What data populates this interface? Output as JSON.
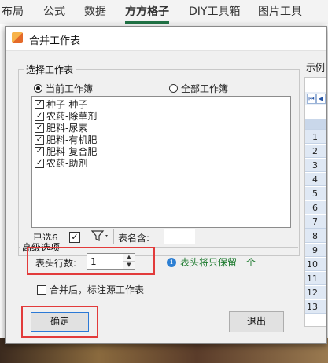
{
  "ribbon": {
    "tabs": [
      "布局",
      "公式",
      "数据",
      "方方格子",
      "DIY工具箱",
      "图片工具"
    ],
    "active_tab": "方方格子"
  },
  "dialog": {
    "title": "合并工作表",
    "select_group": {
      "label": "选择工作表",
      "radio_current": "当前工作簿",
      "radio_all": "全部工作簿",
      "selected_radio": "当前工作簿",
      "items": [
        {
          "label": "种子-种子",
          "checked": true
        },
        {
          "label": "农药-除草剂",
          "checked": true
        },
        {
          "label": "肥料-尿素",
          "checked": true
        },
        {
          "label": "肥料-有机肥",
          "checked": true
        },
        {
          "label": "肥料-复合肥",
          "checked": true
        },
        {
          "label": "农药-助剂",
          "checked": true
        }
      ],
      "selected_count": "已选6",
      "sheet_name_contains": "表名含:"
    },
    "advanced": {
      "label": "高级选项",
      "header_rows_label": "表头行数:",
      "header_rows_value": "1",
      "info_text": "表头将只保留一个",
      "mark_source_label": "合并后，标注源工作表"
    },
    "buttons": {
      "ok": "确定",
      "exit": "退出"
    },
    "sample": {
      "label": "示例",
      "row_numbers": [
        "1",
        "2",
        "3",
        "4",
        "5",
        "6",
        "7",
        "8",
        "9",
        "10",
        "11",
        "12",
        "13"
      ]
    }
  },
  "colors": {
    "highlight_red": "#e23b3b",
    "info_green": "#1d7a2e",
    "accent_green": "#217346"
  }
}
